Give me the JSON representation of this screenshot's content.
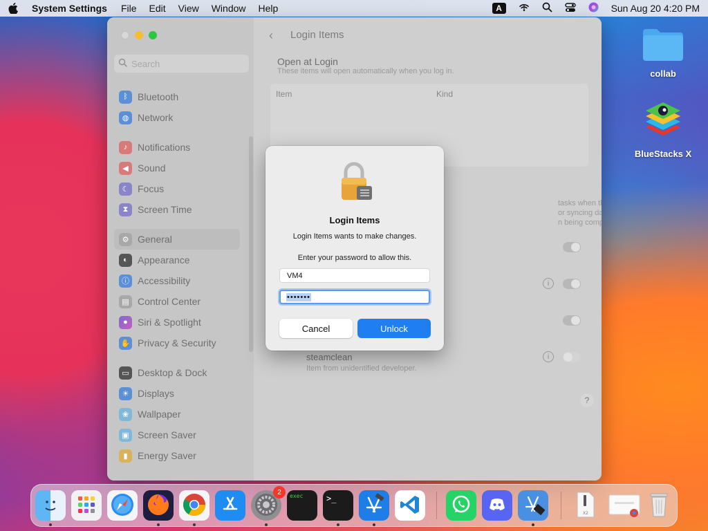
{
  "menubar": {
    "app_name": "System Settings",
    "menus": [
      "File",
      "Edit",
      "View",
      "Window",
      "Help"
    ],
    "input_badge": "A",
    "clock": "Sun Aug 20  4:20 PM"
  },
  "window": {
    "search_placeholder": "Search",
    "sidebar": [
      {
        "label": "Bluetooth",
        "icon": "bluetooth-icon",
        "color": "#3478f6"
      },
      {
        "label": "Network",
        "icon": "globe-icon",
        "color": "#3478f6"
      },
      {
        "label": "Notifications",
        "icon": "bell-icon",
        "color": "#ef4444"
      },
      {
        "label": "Sound",
        "icon": "speaker-icon",
        "color": "#ef4444"
      },
      {
        "label": "Focus",
        "icon": "moon-icon",
        "color": "#6366f1"
      },
      {
        "label": "Screen Time",
        "icon": "hourglass-icon",
        "color": "#6366f1"
      },
      {
        "label": "General",
        "icon": "gear-icon",
        "color": "#9a9a9a"
      },
      {
        "label": "Appearance",
        "icon": "appearance-icon",
        "color": "#222222"
      },
      {
        "label": "Accessibility",
        "icon": "accessibility-icon",
        "color": "#3478f6"
      },
      {
        "label": "Control Center",
        "icon": "control-center-icon",
        "color": "#9a9a9a"
      },
      {
        "label": "Siri & Spotlight",
        "icon": "siri-icon",
        "color": "#c026d3"
      },
      {
        "label": "Privacy & Security",
        "icon": "hand-icon",
        "color": "#3478f6"
      },
      {
        "label": "Desktop & Dock",
        "icon": "dock-icon",
        "color": "#222222"
      },
      {
        "label": "Displays",
        "icon": "sun-icon",
        "color": "#3478f6"
      },
      {
        "label": "Wallpaper",
        "icon": "wallpaper-icon",
        "color": "#38bdf8"
      },
      {
        "label": "Screen Saver",
        "icon": "screensaver-icon",
        "color": "#38bdf8"
      },
      {
        "label": "Energy Saver",
        "icon": "battery-icon",
        "color": "#f59e0b"
      }
    ],
    "selected_item": "General",
    "page_title": "Login Items",
    "open_at_login": {
      "heading": "Open at Login",
      "subheading": "These items will open automatically when you log in.",
      "columns": [
        "Item",
        "Kind"
      ]
    },
    "background_text_lines": [
      "tasks when the application isn't",
      "or syncing data. Turning off a",
      "n being completed."
    ],
    "steamclean": {
      "name": "steamclean",
      "subtitle": "Item from unidentified developer."
    },
    "help_label": "?"
  },
  "dialog": {
    "title": "Login Items",
    "message": "Login Items wants to make changes.",
    "prompt": "Enter your password to allow this.",
    "username": "VM4",
    "password_mask": "•••••••",
    "cancel_label": "Cancel",
    "unlock_label": "Unlock"
  },
  "desktop": {
    "icons": [
      {
        "label": "collab",
        "icon": "folder-icon"
      },
      {
        "label": "BlueStacks X",
        "icon": "bluestacks-icon"
      }
    ]
  },
  "dock": {
    "settings_badge": "2",
    "apps": [
      "Finder",
      "Launchpad",
      "Safari",
      "Firefox",
      "Chrome",
      "App Store",
      "System Settings",
      "exec",
      "Terminal",
      "Xcode",
      "VS Code",
      "WhatsApp",
      "Discord",
      "Xcode Tools",
      "Document",
      "Chrome Window",
      "Trash"
    ]
  },
  "colors": {
    "accent": "#1f7ef0",
    "focus_ring": "#5b9cf0"
  }
}
